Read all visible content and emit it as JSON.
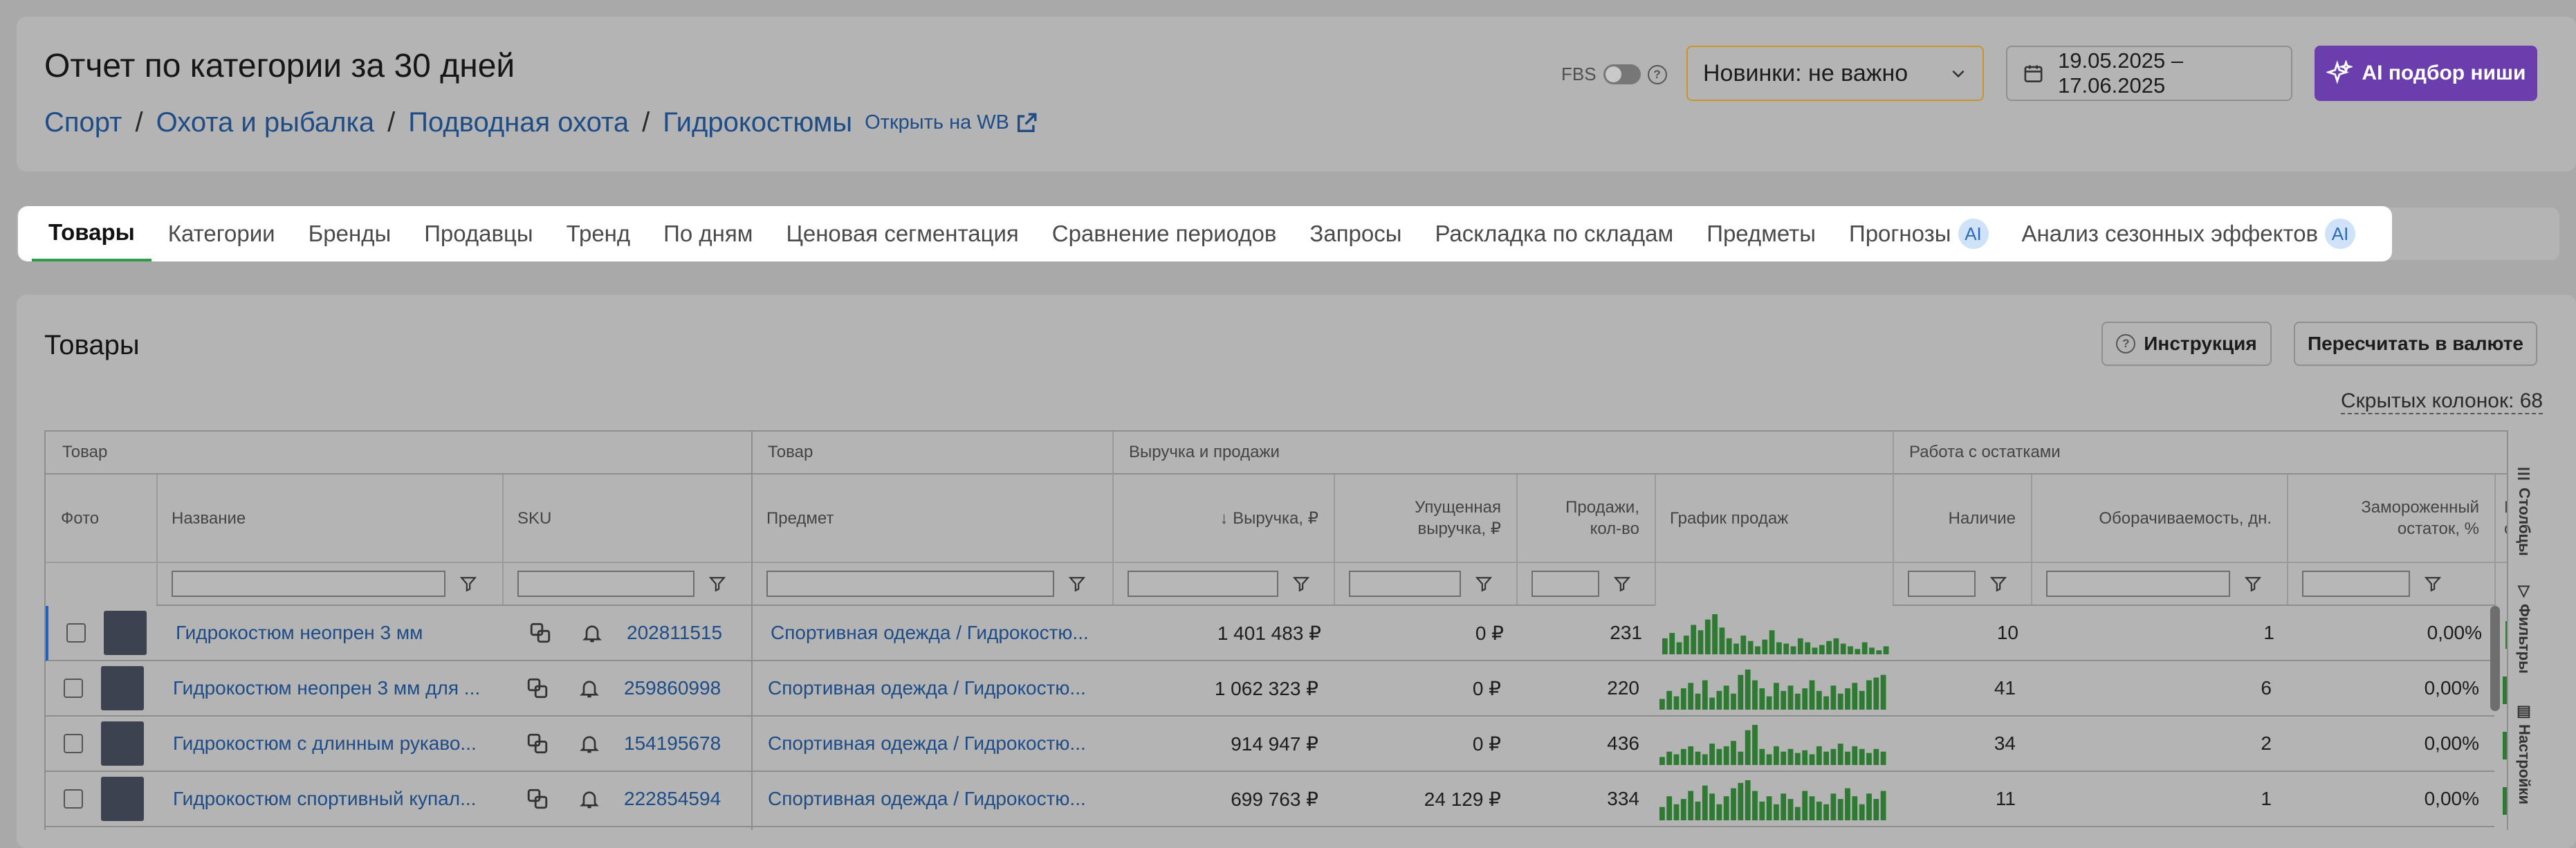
{
  "header": {
    "title": "Отчет по категории за 30 дней",
    "breadcrumbs": [
      "Спорт",
      "Охота и рыбалка",
      "Подводная охота",
      "Гидрокостюмы"
    ],
    "open_wb": "Открыть на WB",
    "fbs_label": "FBS",
    "novelty_select": "Новинки: не важно",
    "date_range": "19.05.2025 – 17.06.2025",
    "ai_button": "AI подбор ниши"
  },
  "tabs": [
    {
      "label": "Товары",
      "active": true
    },
    {
      "label": "Категории"
    },
    {
      "label": "Бренды"
    },
    {
      "label": "Продавцы"
    },
    {
      "label": "Тренд"
    },
    {
      "label": "По дням"
    },
    {
      "label": "Ценовая сегментация"
    },
    {
      "label": "Сравнение периодов"
    },
    {
      "label": "Запросы"
    },
    {
      "label": "Раскладка по складам"
    },
    {
      "label": "Предметы"
    },
    {
      "label": "Прогнозы",
      "badge": "AI"
    },
    {
      "label": "Анализ сезонных эффектов",
      "badge": "AI"
    }
  ],
  "section": {
    "title": "Товары",
    "instruction_button": "Инструкция",
    "recalc_button": "Пересчитать в валюте",
    "hidden_columns": "Скрытых колонок: 68"
  },
  "table": {
    "groups": [
      "Товар",
      "Товар",
      "Выручка и продажи",
      "Работа с остатками"
    ],
    "columns": {
      "photo": "Фото",
      "name": "Название",
      "sku": "SKU",
      "subject": "Предмет",
      "revenue": "↓ Выручка, ₽",
      "lost_revenue": "Упущенная выручка, ₽",
      "sales": "Продажи, кол-во",
      "sales_chart": "График продаж",
      "stock": "Наличие",
      "turnover": "Оборачиваемость, дн.",
      "frozen": "Замороженный остаток, %",
      "cut": "Гра скл"
    },
    "rows": [
      {
        "name": "Гидрокостюм неопрен 3 мм",
        "sku": "202811515",
        "subject": "Спортивная одежда / Гидрокостю...",
        "revenue": "1 401 483 ₽",
        "lost": "0 ₽",
        "sales": "231",
        "stock": "10",
        "turnover": "1",
        "frozen": "0,00%",
        "spark": [
          12,
          16,
          9,
          14,
          22,
          18,
          26,
          30,
          20,
          12,
          8,
          14,
          10,
          6,
          11,
          18,
          9,
          8,
          6,
          12,
          9,
          5,
          7,
          10,
          12,
          8,
          6,
          4,
          9,
          5,
          3,
          6
        ]
      },
      {
        "name": "Гидрокостюм неопрен 3 мм для ...",
        "sku": "259860998",
        "subject": "Спортивная одежда / Гидрокостю...",
        "revenue": "1 062 323 ₽",
        "lost": "0 ₽",
        "sales": "220",
        "stock": "41",
        "turnover": "6",
        "frozen": "0,00%",
        "spark": [
          8,
          14,
          10,
          16,
          20,
          12,
          22,
          9,
          14,
          18,
          12,
          26,
          30,
          22,
          16,
          10,
          20,
          14,
          18,
          12,
          16,
          22,
          14,
          10,
          18,
          12,
          16,
          20,
          14,
          22,
          24,
          26
        ]
      },
      {
        "name": "Гидрокостюм с длинным рукаво...",
        "sku": "154195678",
        "subject": "Спортивная одежда / Гидрокостю...",
        "revenue": "914 947 ₽",
        "lost": "0 ₽",
        "sales": "436",
        "stock": "34",
        "turnover": "2",
        "frozen": "0,00%",
        "spark": [
          6,
          10,
          8,
          12,
          14,
          10,
          8,
          16,
          12,
          14,
          18,
          10,
          26,
          30,
          12,
          8,
          14,
          10,
          12,
          9,
          11,
          8,
          14,
          10,
          12,
          16,
          10,
          14,
          12,
          9,
          12,
          10
        ]
      },
      {
        "name": "Гидрокостюм спортивный купал...",
        "sku": "222854594",
        "subject": "Спортивная одежда / Гидрокостю...",
        "revenue": "699 763 ₽",
        "lost": "24 129 ₽",
        "sales": "334",
        "stock": "11",
        "turnover": "1",
        "frozen": "0,00%",
        "spark": [
          10,
          18,
          12,
          16,
          22,
          14,
          26,
          20,
          12,
          18,
          24,
          28,
          30,
          22,
          14,
          18,
          12,
          20,
          16,
          10,
          22,
          18,
          14,
          12,
          20,
          16,
          24,
          18,
          12,
          20,
          16,
          22
        ]
      }
    ]
  },
  "side_panel": [
    "Столбцы",
    "Фильтры",
    "Настройки"
  ],
  "colors": {
    "accent_purple": "#6a3fad",
    "link_blue": "#1e4c87",
    "bar_green": "#2e7a33",
    "active_tab": "#2f9a4a"
  }
}
